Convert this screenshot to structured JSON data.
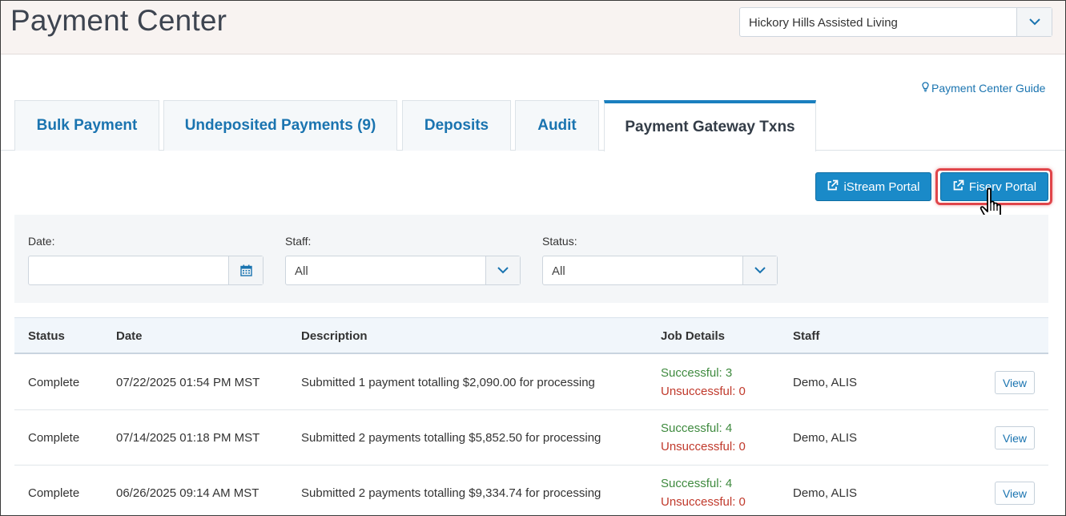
{
  "header": {
    "title": "Payment Center",
    "facility": "Hickory Hills Assisted Living"
  },
  "guide_link": "Payment Center Guide",
  "tabs": [
    {
      "label": "Bulk Payment",
      "active": false
    },
    {
      "label": "Undeposited Payments (9)",
      "active": false
    },
    {
      "label": "Deposits",
      "active": false
    },
    {
      "label": "Audit",
      "active": false
    },
    {
      "label": "Payment Gateway Txns",
      "active": true
    }
  ],
  "portals": {
    "istream_label": "iStream Portal",
    "fiserv_label": "Fiserv Portal"
  },
  "filters": {
    "date_label": "Date:",
    "date_value": "",
    "staff_label": "Staff:",
    "staff_value": "All",
    "status_label": "Status:",
    "status_value": "All"
  },
  "table": {
    "columns": [
      "Status",
      "Date",
      "Description",
      "Job Details",
      "Staff"
    ],
    "rows": [
      {
        "status": "Complete",
        "date": "07/22/2025 01:54 PM MST",
        "description": "Submitted 1 payment totalling $2,090.00 for processing",
        "successful": "Successful: 3",
        "unsuccessful": "Unsuccessful: 0",
        "staff": "Demo, ALIS",
        "action": "View"
      },
      {
        "status": "Complete",
        "date": "07/14/2025 01:18 PM MST",
        "description": "Submitted 2 payments totalling $5,852.50 for processing",
        "successful": "Successful: 4",
        "unsuccessful": "Unsuccessful: 0",
        "staff": "Demo, ALIS",
        "action": "View"
      },
      {
        "status": "Complete",
        "date": "06/26/2025 09:14 AM MST",
        "description": "Submitted 2 payments totalling $9,334.74 for processing",
        "successful": "Successful: 4",
        "unsuccessful": "Unsuccessful: 0",
        "staff": "Demo, ALIS",
        "action": "View"
      }
    ]
  },
  "colors": {
    "accent": "#1a74b0",
    "button": "#1a8ac8",
    "highlight": "#e0454a",
    "success": "#3e8a3e",
    "failure": "#c0392b"
  }
}
